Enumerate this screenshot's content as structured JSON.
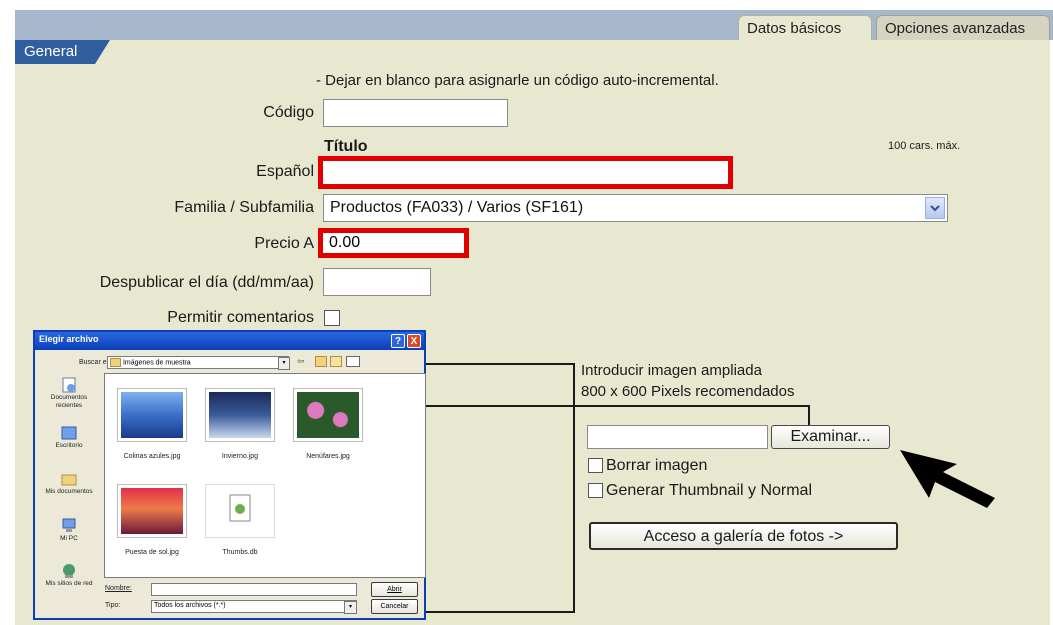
{
  "tabs": [
    {
      "label": "Datos básicos",
      "active": true
    },
    {
      "label": "Opciones avanzadas",
      "active": false
    }
  ],
  "section_tab": "General",
  "hint_text": "- Dejar en blanco para asignarle un código auto-incremental.",
  "form": {
    "codigo_label": "Código",
    "codigo_value": "",
    "titulo_header": "Título",
    "max_chars": "100 cars. máx.",
    "espanol_label": "Español",
    "espanol_value": "",
    "familia_label": "Familia / Subfamilia",
    "familia_value": "Productos (FA033) / Varios (SF161)",
    "precio_label": "Precio A",
    "precio_value": "0.00",
    "despublicar_label": "Despublicar el día (dd/mm/aa)",
    "despublicar_value": "",
    "permitir_label": "Permitir comentarios",
    "permitir_checked": false
  },
  "image": {
    "intro_line1": "Introducir imagen ampliada",
    "intro_line2": "800 x 600 Pixels recomendados",
    "file_value": "",
    "examinar_label": "Examinar...",
    "borrar_label": "Borrar imagen",
    "generar_label": "Generar Thumbnail y Normal",
    "galeria_label": "Acceso a galería de fotos ->"
  },
  "dialog": {
    "title": "Elegir archivo",
    "help_btn": "?",
    "close_btn": "X",
    "buscar_label": "Buscar en:",
    "buscar_value": "Imágenes de muestra",
    "sidebar": [
      {
        "label": "Documentos recientes",
        "icon": "recent-documents-icon"
      },
      {
        "label": "Escritorio",
        "icon": "desktop-icon"
      },
      {
        "label": "Mis documentos",
        "icon": "my-documents-icon"
      },
      {
        "label": "Mi PC",
        "icon": "my-computer-icon"
      },
      {
        "label": "Mis sitios de red",
        "icon": "network-places-icon"
      }
    ],
    "files": [
      {
        "name": "Colinas azules.jpg"
      },
      {
        "name": "Invierno.jpg"
      },
      {
        "name": "Nenúfares.jpg"
      },
      {
        "name": "Puesta de sol.jpg"
      },
      {
        "name": "Thumbs.db"
      }
    ],
    "nombre_label": "Nombre:",
    "nombre_value": "",
    "tipo_label": "Tipo:",
    "tipo_value": "Todos los archivos (*.*)",
    "abrir_label": "Abrir",
    "cancelar_label": "Cancelar"
  },
  "colors": {
    "panel_bg": "#e8e8d0",
    "tab_strip": "#a8b8cc",
    "section_tab": "#2f5f9f",
    "highlight_red": "#e00000",
    "dialog_title": "#0a3fb8"
  }
}
